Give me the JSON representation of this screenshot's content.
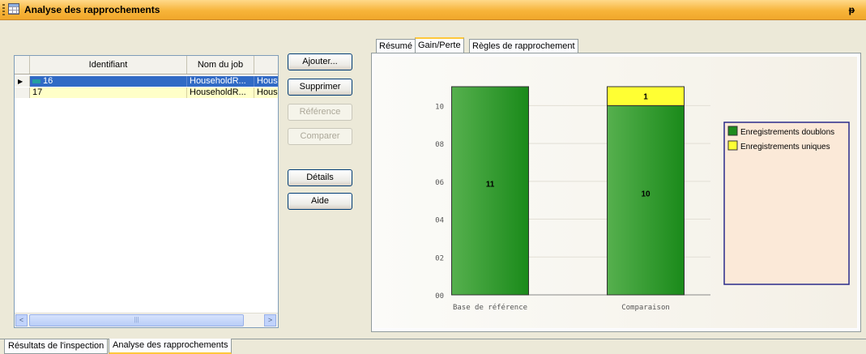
{
  "window": {
    "title": "Analyse des rapprochements",
    "pin_icon": "pin-icon",
    "pin_glyph": "ᵽ"
  },
  "grid": {
    "columns": [
      "Identifiant",
      "Nom du job"
    ],
    "rows": [
      {
        "id": "16",
        "job": "HouseholdR...",
        "extra": "Hous",
        "selected": true,
        "current": true
      },
      {
        "id": "17",
        "job": "HouseholdR...",
        "extra": "Hous",
        "selected": false,
        "current": false
      }
    ],
    "scroll_left": "<",
    "scroll_right": ">",
    "scroll_grip": "|||"
  },
  "buttons": {
    "ajouter": "Ajouter...",
    "supprimer": "Supprimer",
    "reference": "Référence",
    "comparer": "Comparer",
    "details": "Détails",
    "aide": "Aide"
  },
  "tabs": [
    "Résumé",
    "Gain/Perte",
    "Règles de rapprochement"
  ],
  "active_tab": "Gain/Perte",
  "bottom_tabs": [
    "Résultats de l'inspection",
    "Analyse des rapprochements"
  ],
  "active_bottom_tab": "Analyse des rapprochements",
  "colors": {
    "doublons": "#1e8b1e",
    "uniques": "#ffff33",
    "legend_border": "#2a2a8a",
    "legend_bg": "#fbe9d8"
  },
  "chart_data": {
    "type": "bar",
    "stacked": true,
    "categories": [
      "Base de référence",
      "Comparaison"
    ],
    "series": [
      {
        "name": "Enregistrements doublons",
        "values": [
          11,
          10
        ],
        "labels": [
          "11",
          "10"
        ]
      },
      {
        "name": "Enregistrements uniques",
        "values": [
          0,
          1
        ],
        "labels": [
          "",
          "1"
        ]
      }
    ],
    "yticks": [
      "00",
      "02",
      "04",
      "06",
      "08",
      "10"
    ],
    "ytick_values": [
      0,
      2,
      4,
      6,
      8,
      10
    ],
    "ylim": [
      0,
      11
    ],
    "grid": true,
    "legend_position": "right"
  }
}
